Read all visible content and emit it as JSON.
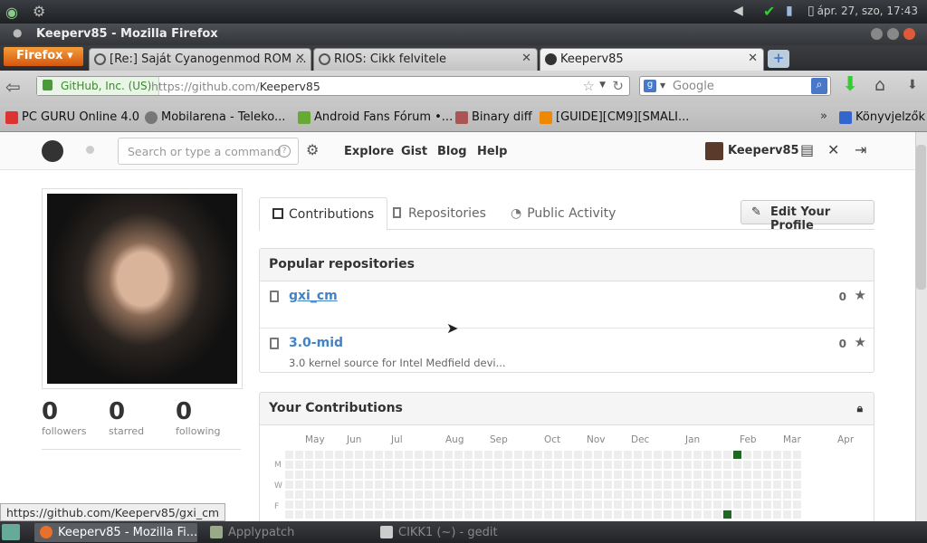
{
  "system": {
    "clock": "ápr. 27, szo, 17:43"
  },
  "window": {
    "title": "Keeperv85 - Mozilla Firefox"
  },
  "browser": {
    "menu_label": "Firefox",
    "tabs": [
      {
        "label": "[Re:] Saját Cyanogenmod ROM ...",
        "active": false
      },
      {
        "label": "RIOS: Cikk felvitele",
        "active": false
      },
      {
        "label": "Keeperv85",
        "active": true
      }
    ],
    "new_tab": "+",
    "identity": "GitHub, Inc. (US)",
    "url_prefix": "https://github.com/",
    "url_path": "Keeperv85",
    "search_placeholder": "Google",
    "bookmarks": [
      {
        "label": "PC GURU Online 4.0",
        "color": "#d33"
      },
      {
        "label": "Mobilarena - Teleko...",
        "color": "#777"
      },
      {
        "label": "Android Fans Fórum •...",
        "color": "#6a3"
      },
      {
        "label": "Binary diff",
        "color": "#a55"
      },
      {
        "label": "[GUIDE][CM9][SMALI...",
        "color": "#e80"
      },
      {
        "label": "Könyvjelzők",
        "color": "#36c"
      }
    ]
  },
  "github": {
    "search_placeholder": "Search or type a command",
    "nav": [
      "Explore",
      "Gist",
      "Blog",
      "Help"
    ],
    "username": "Keeperv85",
    "stats": [
      {
        "value": "0",
        "label": "followers"
      },
      {
        "value": "0",
        "label": "starred"
      },
      {
        "value": "0",
        "label": "following"
      }
    ],
    "tabs": [
      "Contributions",
      "Repositories",
      "Public Activity"
    ],
    "edit_profile": "Edit Your Profile",
    "popular_title": "Popular repositories",
    "repos": [
      {
        "name": "gxi_cm",
        "description": "",
        "stars": "0"
      },
      {
        "name": "3.0-mid",
        "description": "3.0 kernel source for Intel Medfield devi...",
        "stars": "0"
      }
    ],
    "contrib_title": "Your Contributions",
    "months": [
      "May",
      "Jun",
      "Jul",
      "Aug",
      "Sep",
      "Oct",
      "Nov",
      "Dec",
      "Jan",
      "Feb",
      "Mar",
      "Apr"
    ],
    "days": [
      "M",
      "W",
      "F"
    ]
  },
  "status_url": "https://github.com/Keeperv85/gxi_cm",
  "taskbar": [
    {
      "label": "Keeperv85 - Mozilla Fi...",
      "active": true
    },
    {
      "label": "Applypatch",
      "active": false
    },
    {
      "label": "CIKK1 (~) - gedit",
      "active": false
    }
  ]
}
